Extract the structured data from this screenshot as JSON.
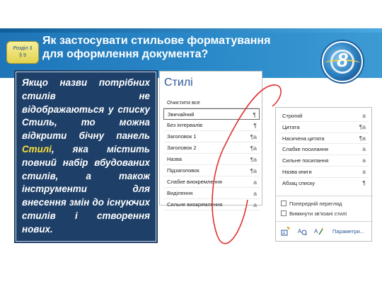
{
  "slide": {
    "badge_line1": "Розділ 3",
    "badge_line2": "§ 9",
    "title_line1": "Як застосувати стильове форматування",
    "title_line2": "для оформлення документа?",
    "grade_number": "8",
    "body_before": "Якщо назви потрібних стилів не відображаються у списку Стиль, то можна відкрити бічну панель ",
    "body_highlight": "Стилі",
    "body_after": ", яка містить повний набір вбудованих стилів, а також інструменти для внесення змін до існуючих стилів і створення нових."
  },
  "styles_pane": {
    "title": "Стилі",
    "items": [
      {
        "label": "Очистити все",
        "mark": ""
      },
      {
        "label": "Звичайний",
        "mark": "¶"
      },
      {
        "label": "Без інтервалів",
        "mark": "¶"
      },
      {
        "label": "Заголовок 1",
        "mark": "¶a"
      },
      {
        "label": "Заголовок 2",
        "mark": "¶a"
      },
      {
        "label": "Назва",
        "mark": "¶a"
      },
      {
        "label": "Підзаголовок",
        "mark": "¶a"
      },
      {
        "label": "Слабке виокремлення",
        "mark": "a"
      },
      {
        "label": "Виділення",
        "mark": "a"
      },
      {
        "label": "Сильне виокремлення",
        "mark": "a"
      }
    ]
  },
  "styles_pane_continued": {
    "items": [
      {
        "label": "Строгий",
        "mark": "a"
      },
      {
        "label": "Цитата",
        "mark": "¶a"
      },
      {
        "label": "Насичена цитата",
        "mark": "¶a"
      },
      {
        "label": "Слабке посилання",
        "mark": "a"
      },
      {
        "label": "Сильне посилання",
        "mark": "a"
      },
      {
        "label": "Назва книги",
        "mark": "a"
      },
      {
        "label": "Абзац списку",
        "mark": "¶"
      }
    ],
    "preview_label": "Попередній перегляд",
    "linked_label": "Вимкнути зв'язані стилі",
    "new_style_icon": "new-style-icon",
    "inspector_icon": "style-inspector-icon",
    "manage_icon": "manage-styles-icon",
    "options_label": "Параметри..."
  },
  "colors": {
    "header": "#2a89c9",
    "textbox": "#1e3f67",
    "highlight": "#ffe03a",
    "pane_title": "#2b579a",
    "curve": "#e03030"
  }
}
